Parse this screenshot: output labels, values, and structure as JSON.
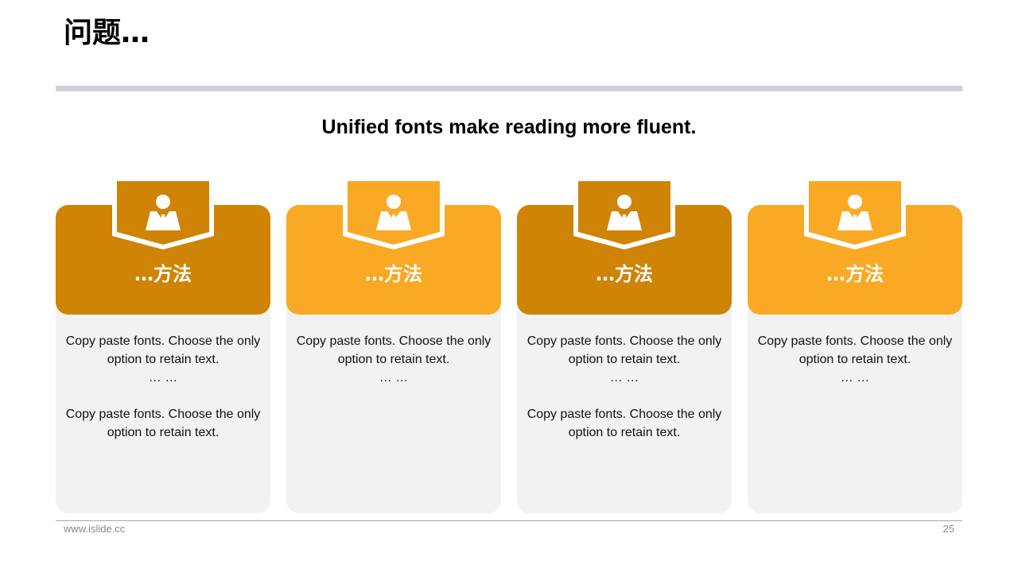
{
  "slide": {
    "title": "问题…",
    "subtitle": "Unified fonts make reading more fluent.",
    "footer_url": "www.islide.cc",
    "page_number": "25"
  },
  "colors": {
    "dark_gold": "#cf8406",
    "amber": "#f9a924",
    "card_body": "#f2f2f2",
    "rule": "#cdd0d8"
  },
  "cards": [
    {
      "icon": "person-icon",
      "heading": "…方法",
      "para1": "Copy paste fonts. Choose the only\noption to retain text.",
      "ellipsis": "… …",
      "para2": "Copy paste fonts. Choose the only\noption to retain text."
    },
    {
      "icon": "person-icon",
      "heading": "…方法",
      "para1": "Copy paste fonts. Choose the only\noption to retain text.",
      "ellipsis": "… …"
    },
    {
      "icon": "person-icon",
      "heading": "…方法",
      "para1": "Copy paste fonts. Choose the only\noption to retain text.",
      "ellipsis": "… …",
      "para2": "Copy paste fonts. Choose the only\noption to retain text."
    },
    {
      "icon": "person-icon",
      "heading": "…方法",
      "para1": "Copy paste fonts. Choose the only\noption to retain text.",
      "ellipsis": "… …"
    }
  ]
}
